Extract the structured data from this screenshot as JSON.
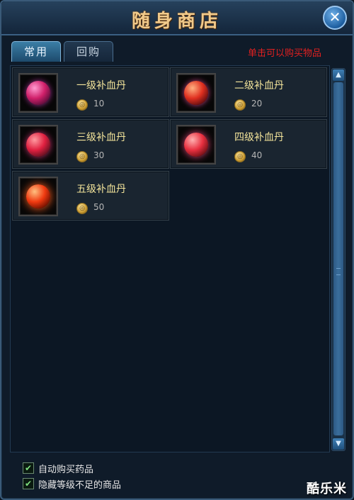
{
  "window": {
    "title": "随身商店"
  },
  "tabs": [
    {
      "label": "常用",
      "active": true
    },
    {
      "label": "回购",
      "active": false
    }
  ],
  "hint": "单击可以购买物品",
  "items": [
    {
      "name": "一级补血丹",
      "price": "10",
      "icon": "red-potion-orb-icon"
    },
    {
      "name": "二级补血丹",
      "price": "20",
      "icon": "red-potion-orb-icon"
    },
    {
      "name": "三级补血丹",
      "price": "30",
      "icon": "red-potion-orb-icon"
    },
    {
      "name": "四级补血丹",
      "price": "40",
      "icon": "red-potion-orb-icon"
    },
    {
      "name": "五级补血丹",
      "price": "50",
      "icon": "red-potion-orb-icon"
    }
  ],
  "options": [
    {
      "label": "自动购买药品",
      "checked": true
    },
    {
      "label": "隐藏等级不足的商品",
      "checked": true
    }
  ],
  "watermark": "酷乐米",
  "colors": {
    "title": "#f0c98a",
    "hint": "#e02020",
    "item_name": "#f2e39a",
    "price": "#b5b5b5"
  }
}
